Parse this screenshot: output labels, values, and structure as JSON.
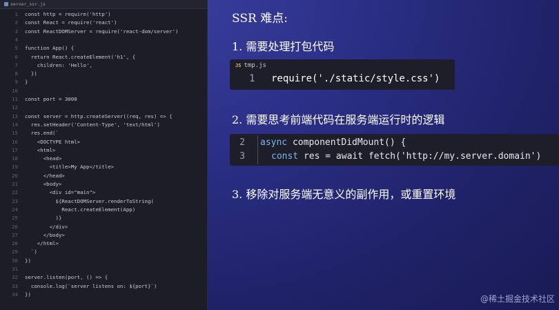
{
  "editor": {
    "tab_label": "server_ssr.js",
    "lines": [
      {
        "n": "1",
        "text": "const http = require('http')"
      },
      {
        "n": "2",
        "text": "const React = require('react')"
      },
      {
        "n": "3",
        "text": "const ReactDOMServer = require('react-dom/server')"
      },
      {
        "n": "4",
        "text": ""
      },
      {
        "n": "5",
        "text": "function App() {"
      },
      {
        "n": "6",
        "text": "  return React.createElement('h1', {"
      },
      {
        "n": "7",
        "text": "    children: 'Hello',"
      },
      {
        "n": "8",
        "text": "  })"
      },
      {
        "n": "9",
        "text": "}"
      },
      {
        "n": "10",
        "text": ""
      },
      {
        "n": "11",
        "text": "const port = 3000"
      },
      {
        "n": "12",
        "text": ""
      },
      {
        "n": "13",
        "text": "const server = http.createServer((req, res) => {"
      },
      {
        "n": "14",
        "text": "  res.setHeader('Content-Type', 'text/html')"
      },
      {
        "n": "15",
        "text": "  res.end(`"
      },
      {
        "n": "16",
        "text": "    <DOCTYPE html>"
      },
      {
        "n": "17",
        "text": "    <html>"
      },
      {
        "n": "18",
        "text": "      <head>"
      },
      {
        "n": "19",
        "text": "        <title>My App</title>"
      },
      {
        "n": "20",
        "text": "      </head>"
      },
      {
        "n": "21",
        "text": "      <body>"
      },
      {
        "n": "22",
        "text": "        <div id=\"main\">"
      },
      {
        "n": "23",
        "text": "          ${ReactDOMServer.renderToString("
      },
      {
        "n": "24",
        "text": "            React.createElement(App)"
      },
      {
        "n": "25",
        "text": "          )}"
      },
      {
        "n": "26",
        "text": "        </div>"
      },
      {
        "n": "27",
        "text": "      </body>"
      },
      {
        "n": "28",
        "text": "    </html>"
      },
      {
        "n": "29",
        "text": "  `)"
      },
      {
        "n": "30",
        "text": "})"
      },
      {
        "n": "31",
        "text": ""
      },
      {
        "n": "32",
        "text": "server.listen(port, () => {"
      },
      {
        "n": "33",
        "text": "  console.log(`server listens on: ${port}`)"
      },
      {
        "n": "34",
        "text": "})"
      }
    ]
  },
  "slide": {
    "heading": "SSR 难点:",
    "point1": "1. 需要处理打包代码",
    "point2": "2. 需要思考前端代码在服务端运行时的逻辑",
    "point3": "3. 移除对服务端无意义的副作用，或重置环境"
  },
  "snippet1": {
    "badge": "JS",
    "filename": "tmp.js",
    "line_number": "1",
    "code": "require('./static/style.css')"
  },
  "snippet2": {
    "line1_number": "2",
    "line1_keyword": "async",
    "line1_rest": " componentDidMount() {",
    "line2_number": "3",
    "line2_keyword": "const",
    "line2_rest": " res = await fetch('http://my.server.domain')"
  },
  "watermark": "@稀土掘金技术社区",
  "colors": {
    "background": "#2b2f86",
    "editor_bg": "#1c1d26",
    "keyword": "#7fb4f0"
  }
}
